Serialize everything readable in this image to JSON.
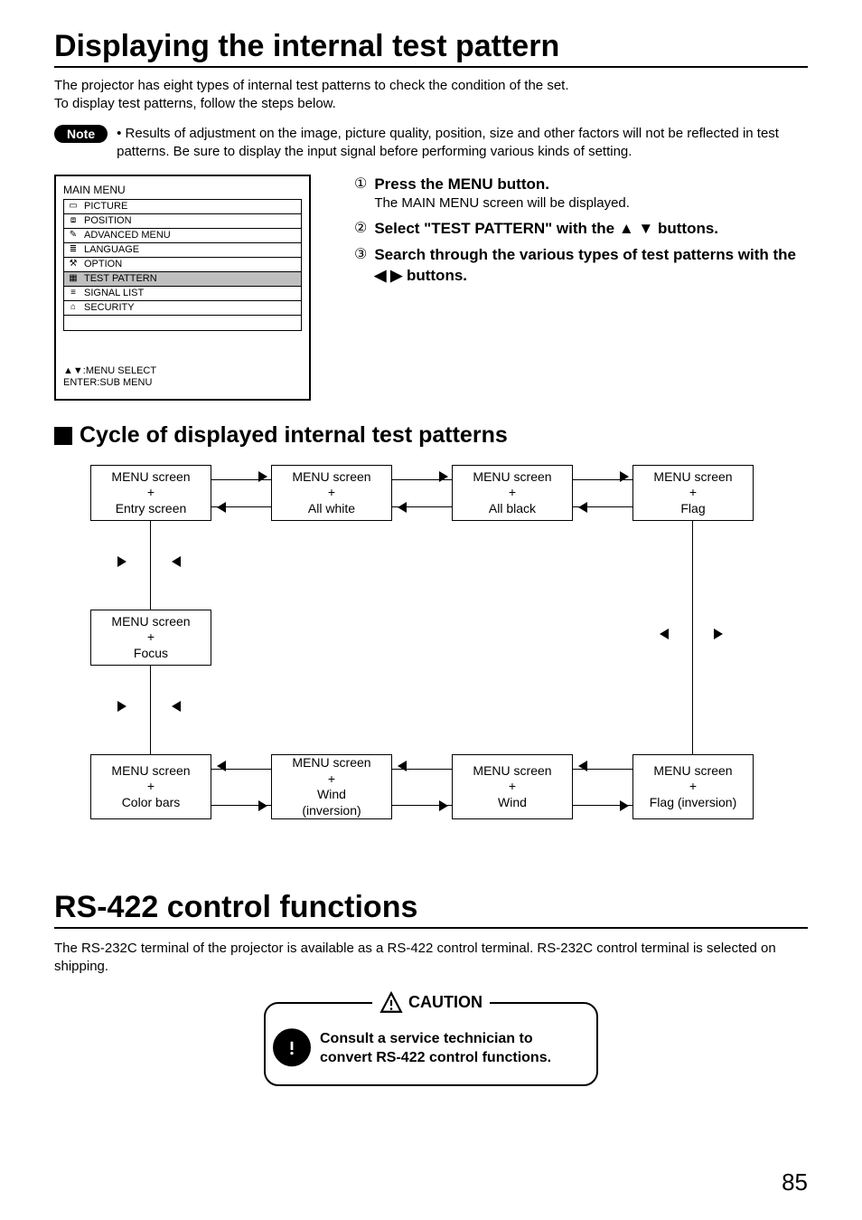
{
  "title1": "Displaying the internal test pattern",
  "intro1": "The projector has eight types of internal test patterns to check the condition of the set.",
  "intro2": "To display test patterns, follow the steps below.",
  "note_label": "Note",
  "note_body": "• Results of adjustment on the image, picture quality, position, size and other factors will not be reflected in test patterns.  Be sure to display the input signal before performing various kinds of setting.",
  "menu": {
    "title": "MAIN MENU",
    "items": [
      {
        "label": "PICTURE",
        "hl": false
      },
      {
        "label": "POSITION",
        "hl": false
      },
      {
        "label": "ADVANCED MENU",
        "hl": false
      },
      {
        "label": "LANGUAGE",
        "hl": false
      },
      {
        "label": "OPTION",
        "hl": false
      },
      {
        "label": "TEST PATTERN",
        "hl": true
      },
      {
        "label": "SIGNAL LIST",
        "hl": false
      },
      {
        "label": "SECURITY",
        "hl": false
      }
    ],
    "footer1": "▲▼:MENU SELECT",
    "footer2": "ENTER:SUB MENU"
  },
  "steps": {
    "s1_title": "Press the MENU button.",
    "s1_sub": "The MAIN MENU screen will be displayed.",
    "s2_a": "Select \"TEST PATTERN\" with the ",
    "s2_b": "buttons.",
    "s3_a": "Search through the various types of test patterns with the ",
    "s3_b": " buttons."
  },
  "h2": "Cycle of displayed internal test patterns",
  "cycle": {
    "c1": "MENU screen\n+\nEntry screen",
    "c2": "MENU screen\n+\nAll white",
    "c3": "MENU screen\n+\nAll black",
    "c4": "MENU screen\n+\nFlag",
    "c5": "MENU screen\n+\nFocus",
    "c6": "MENU screen\n+\nColor bars",
    "c7": "MENU screen\n+\nWind\n(inversion)",
    "c8": "MENU screen\n+\nWind",
    "c9": "MENU screen\n+\nFlag (inversion)"
  },
  "title2": "RS-422 control functions",
  "rs_intro": "The RS-232C terminal of the projector is available as a RS-422 control terminal. RS-232C control terminal is selected on shipping.",
  "caution_label": "CAUTION",
  "caution_body": "Consult a service technician to convert RS-422 control functions.",
  "page_num": "85"
}
